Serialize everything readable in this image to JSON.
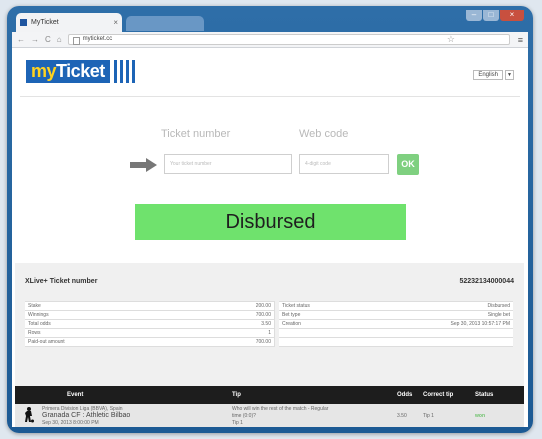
{
  "browser": {
    "tab_title": "MyTicket",
    "tab_close": "×",
    "window_buttons": [
      "–",
      "□",
      "×"
    ],
    "nav_icons": [
      "←",
      "→",
      "C",
      "⌂"
    ],
    "address": "myticket.cc",
    "star": "☆",
    "menu": "≡"
  },
  "logo": {
    "my": "my",
    "ticket": "Ticket"
  },
  "language": {
    "selected": "English",
    "arrow": "▼"
  },
  "form": {
    "ticket_number_label": "Ticket number",
    "ticket_number_placeholder": "Your ticket number",
    "web_code_label": "Web code",
    "web_code_placeholder": "4-digit code",
    "ok_label": "OK"
  },
  "status": {
    "text": "Disbursed",
    "color": "#6fe26d"
  },
  "ticket": {
    "header_label": "XLive+ Ticket number",
    "number": "52232134000044",
    "left_rows": [
      {
        "label": "Stake",
        "value": "200.00"
      },
      {
        "label": "Winnings",
        "value": "700.00"
      },
      {
        "label": "Total odds",
        "value": "3.50"
      },
      {
        "label": "Rows",
        "value": "1"
      },
      {
        "label": "Paid-out amount",
        "value": "700.00"
      }
    ],
    "right_rows": [
      {
        "label": "Ticket status",
        "value": "Disbursed"
      },
      {
        "label": "Bet type",
        "value": "Single bet"
      },
      {
        "label": "Creation",
        "value": "Sep 30, 2013 10:57:17 PM"
      }
    ]
  },
  "bets": {
    "columns": {
      "event": "Event",
      "tip": "Tip",
      "odds": "Odds",
      "correct_tip": "Correct tip",
      "status": "Status"
    },
    "row": {
      "league": "Primera Division Liga (BBVA), Spain",
      "match": "Granada CF : Athletic Bilbao",
      "date": "Sep 30, 2013 8:00:00 PM",
      "tip_line1": "Who will win the rest of the match - Regular",
      "tip_line2": "time (0:0)?",
      "tip_line3": "Tip 1",
      "odds": "3.50",
      "correct_tip": "Tip 1",
      "status": "won"
    }
  }
}
